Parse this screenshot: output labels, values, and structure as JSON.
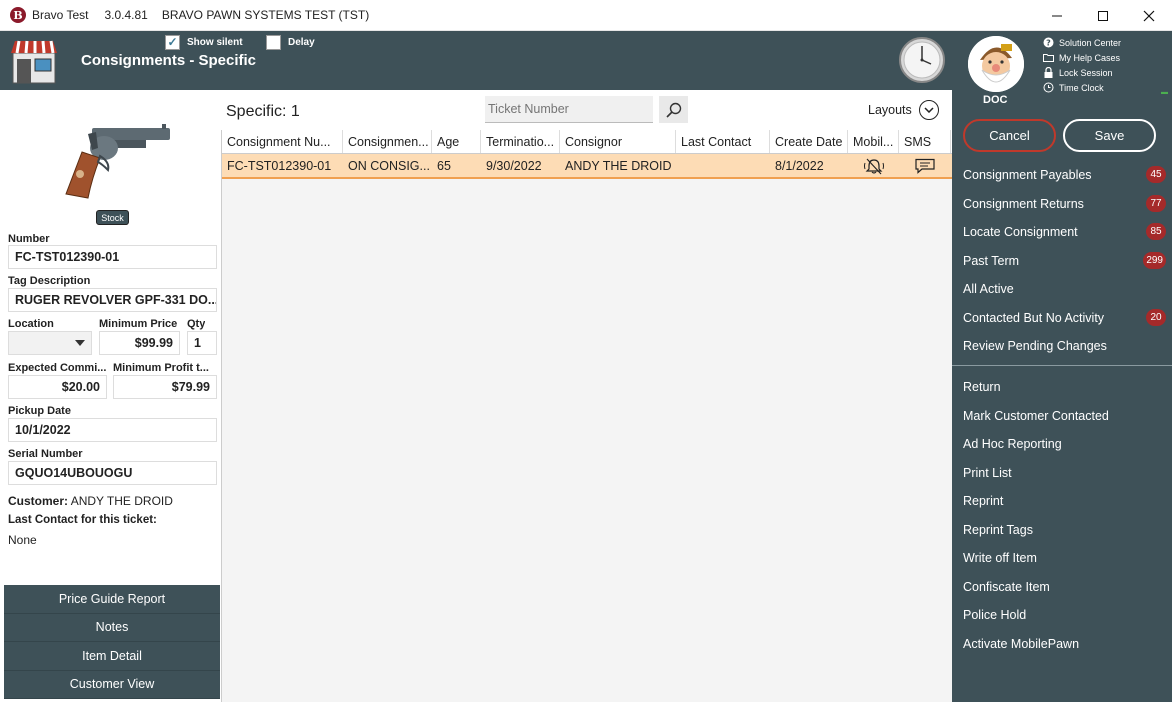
{
  "window": {
    "app_name": "Bravo Test",
    "version": "3.0.4.81",
    "system": "BRAVO PAWN SYSTEMS TEST (TST)",
    "logo_letter": "B"
  },
  "header": {
    "title": "Consignments - Specific",
    "show_silent_label": "Show silent",
    "show_silent_checked": true,
    "delay_label": "Delay",
    "delay_checked": false
  },
  "user": {
    "name": "DOC",
    "links": [
      "Solution Center",
      "My Help Cases",
      "Lock Session",
      "Time Clock"
    ]
  },
  "actions": {
    "cancel": "Cancel",
    "save": "Save"
  },
  "queues": [
    {
      "label": "Consignment Payables",
      "badge": "45"
    },
    {
      "label": "Consignment Returns",
      "badge": "77"
    },
    {
      "label": "Locate Consignment",
      "badge": "85"
    },
    {
      "label": "Past Term",
      "badge": "299"
    },
    {
      "label": "All Active",
      "badge": ""
    },
    {
      "label": "Contacted But No Activity",
      "badge": "20"
    },
    {
      "label": "Review Pending Changes",
      "badge": ""
    }
  ],
  "tasks": [
    "Return",
    "Mark Customer Contacted",
    "Ad Hoc Reporting",
    "Print List",
    "Reprint",
    "Reprint Tags",
    "Write off Item",
    "Confiscate Item",
    "Police Hold",
    "Activate MobilePawn"
  ],
  "item": {
    "stock_label": "Stock",
    "number_label": "Number",
    "number": "FC-TST012390-01",
    "tag_label": "Tag Description",
    "tag": "RUGER REVOLVER GPF-331 DO...",
    "location_label": "Location",
    "location": "",
    "min_price_label": "Minimum Price",
    "min_price": "$99.99",
    "qty_label": "Qty",
    "qty": "1",
    "exp_comm_label": "Expected Commi...",
    "exp_comm": "$20.00",
    "min_profit_label": "Minimum Profit t...",
    "min_profit": "$79.99",
    "pickup_label": "Pickup Date",
    "pickup": "10/1/2022",
    "serial_label": "Serial Number",
    "serial": "GQUO14UBOUOGU",
    "customer_label": "Customer:",
    "customer": "ANDY THE DROID",
    "last_contact_label": "Last Contact for this ticket:",
    "last_contact": "None"
  },
  "left_buttons": [
    "Price Guide Report",
    "Notes",
    "Item Detail",
    "Customer View"
  ],
  "center": {
    "title": "Specific: 1",
    "ticket_placeholder": "Ticket Number",
    "layouts_label": "Layouts"
  },
  "table": {
    "columns": [
      "Consignment Nu...",
      "Consignmen...",
      "Age",
      "Terminatio...",
      "Consignor",
      "Last Contact",
      "Create Date",
      "Mobil...",
      "SMS"
    ],
    "rows": [
      [
        "FC-TST012390-01",
        "ON CONSIG...",
        "65",
        "9/30/2022",
        "ANDY THE DROID",
        "",
        "8/1/2022",
        "",
        ""
      ]
    ]
  },
  "colors": {
    "panel": "#3e5158",
    "badge": "#a52a2a",
    "row_selected": "#fddcb5",
    "cancel_border": "#c0392b"
  }
}
